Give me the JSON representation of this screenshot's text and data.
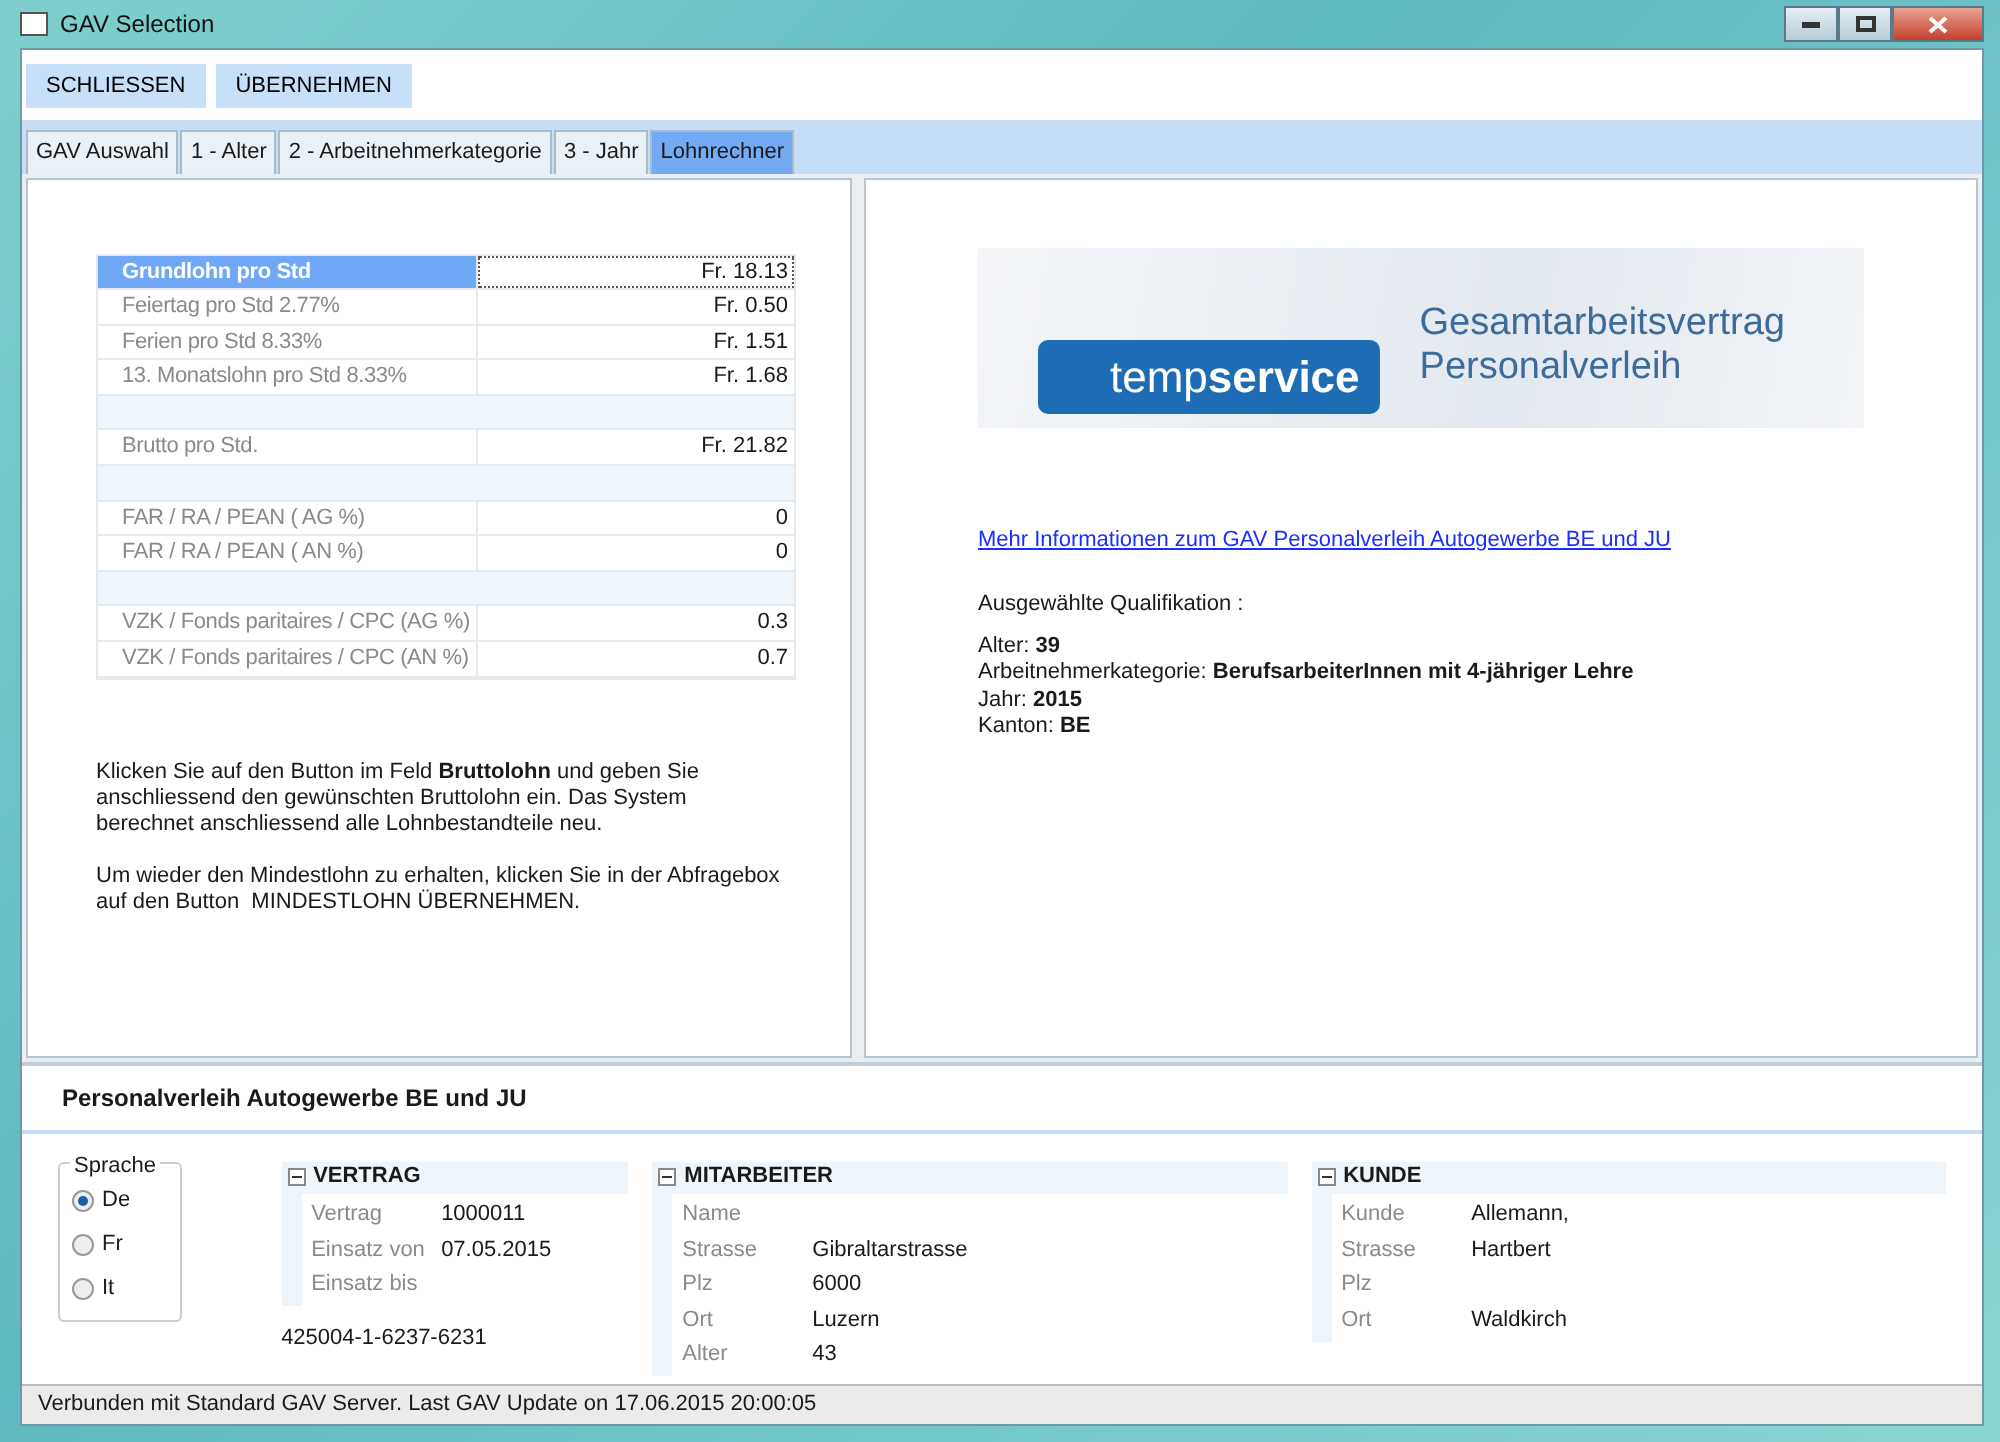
{
  "window": {
    "title": "GAV Selection"
  },
  "toolbar": {
    "buttons": [
      "SCHLIESSEN",
      "ÜBERNEHMEN"
    ]
  },
  "tabs": [
    {
      "label": "GAV Auswahl",
      "selected": false
    },
    {
      "label": "1 - Alter",
      "selected": false
    },
    {
      "label": "2 - Arbeitnehmerkategorie",
      "selected": false
    },
    {
      "label": "3 - Jahr",
      "selected": false
    },
    {
      "label": "Lohnrechner",
      "selected": true
    }
  ],
  "wage_table": [
    {
      "kind": "row",
      "label": "Grundlohn pro Std",
      "value": "Fr. 18.13",
      "selected": true
    },
    {
      "kind": "row",
      "label": "Feiertag pro Std 2.77%",
      "value": "Fr. 0.50",
      "selected": false
    },
    {
      "kind": "row",
      "label": "Ferien pro Std 8.33%",
      "value": "Fr. 1.51",
      "selected": false
    },
    {
      "kind": "row",
      "label": "13. Monatslohn pro Std 8.33%",
      "value": "Fr. 1.68",
      "selected": false
    },
    {
      "kind": "spacer"
    },
    {
      "kind": "row",
      "label": "Brutto pro Std.",
      "value": "Fr. 21.82",
      "selected": false
    },
    {
      "kind": "spacer"
    },
    {
      "kind": "row",
      "label": "FAR / RA / PEAN ( AG %)",
      "value": "0",
      "selected": false
    },
    {
      "kind": "row",
      "label": "FAR / RA / PEAN ( AN %)",
      "value": "0",
      "selected": false
    },
    {
      "kind": "spacer"
    },
    {
      "kind": "row",
      "label": "VZK / Fonds paritaires / CPC (AG %)",
      "value": "0.3",
      "selected": false
    },
    {
      "kind": "row",
      "label": "VZK / Fonds paritaires / CPC (AN %)",
      "value": "0.7",
      "selected": false
    }
  ],
  "help_text": [
    "Klicken Sie auf den Button im Feld **Bruttolohn** und geben Sie anschliessend den gewünschten Bruttolohn ein. Das System berechnet anschliessend alle Lohnbestandteile neu.",
    "Um wieder den Mindestlohn zu erhalten, klicken Sie in der Abfragebox auf den Button  MINDESTLOHN ÜBERNEHMEN."
  ],
  "banner": {
    "logo": "temp**service**",
    "title_lines": [
      "Gesamtarbeitsvertrag",
      "Personalverleih"
    ]
  },
  "info_link": "Mehr Informationen zum GAV Personalverleih Autogewerbe BE und JU",
  "qualification": {
    "heading": "Ausgewählte Qualifikation :",
    "lines": [
      "Alter: **39**",
      "Arbeitnehmerkategorie: **BerufsarbeiterInnen mit 4-jähriger Lehre**",
      "Jahr: **2015**",
      "Kanton: **BE**"
    ]
  },
  "gav_name": "Personalverleih Autogewerbe BE und JU",
  "language": {
    "title": "Sprache",
    "options": [
      {
        "label": "De",
        "selected": true
      },
      {
        "label": "Fr",
        "selected": false
      },
      {
        "label": "It",
        "selected": false
      }
    ]
  },
  "groups": [
    {
      "title": "VERTRAG",
      "expanded": true,
      "fields": [
        {
          "label": "Vertrag",
          "value": "1000011"
        },
        {
          "label": "Einsatz von",
          "value": "07.05.2015"
        },
        {
          "label": "Einsatz bis"
        }
      ],
      "footer": "425004-1-6237-6231"
    },
    {
      "title": "MITARBEITER",
      "expanded": true,
      "fields": [
        {
          "label": "Name"
        },
        {
          "label": "Strasse",
          "value": "Gibraltarstrasse"
        },
        {
          "label": "Plz",
          "value": "6000"
        },
        {
          "label": "Ort",
          "value": "Luzern"
        },
        {
          "label": "Alter",
          "value": "43"
        }
      ]
    },
    {
      "title": "KUNDE",
      "expanded": true,
      "fields": [
        {
          "label": "Kunde",
          "value": "Allemann,"
        },
        {
          "label": "Strasse",
          "value": "Hartbert"
        },
        {
          "label": "Plz"
        },
        {
          "label": "Ort",
          "value": "Waldkirch"
        }
      ]
    }
  ],
  "status_bar": "Verbunden mit Standard GAV Server. Last GAV Update on 17.06.2015 20:00:05"
}
